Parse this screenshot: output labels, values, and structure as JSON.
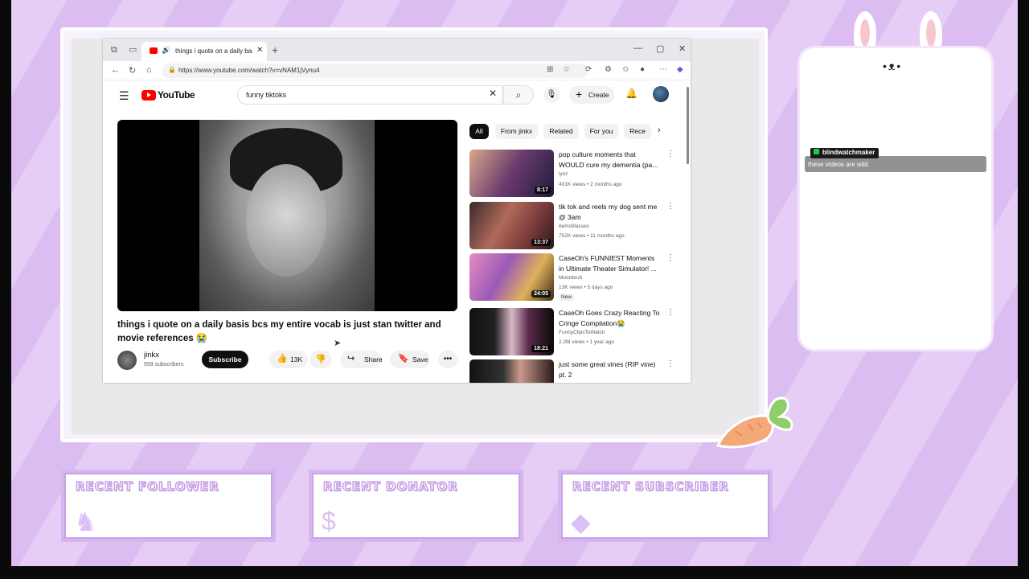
{
  "browser": {
    "tab_title": "things i quote on a daily basis",
    "url": "https://www.youtube.com/watch?v=vNAM1jVynu4"
  },
  "youtube": {
    "logo_text": "YouTube",
    "search_value": "funny tiktoks",
    "create_label": "Create",
    "video_title": "things i quote on a daily basis bcs my entire vocab is just stan twitter and movie references 😭",
    "channel_name": "jinkx",
    "channel_subs": "559 subscribers",
    "subscribe_label": "Subscribe",
    "like_count": "13K",
    "share_label": "Share",
    "save_label": "Save",
    "chips": [
      "All",
      "From jinkx",
      "Related",
      "For you",
      "Rece"
    ],
    "recommendations": [
      {
        "title": "pop culture moments that WOULD cure my dementia (pa...",
        "channel": "iyoz",
        "meta": "401K views • 2 months ago",
        "duration": "8:17",
        "is_new": false
      },
      {
        "title": "tik tok and reels my dog sent me @ 3am",
        "channel": "6ems9lasses",
        "meta": "752K views • 11 months ago",
        "duration": "13:37",
        "is_new": false
      },
      {
        "title": "CaseOh's FUNNIEST Moments in Ultimate Theater Simulator! ...",
        "channel": "Moonbruh",
        "meta": "13K views • 5 days ago",
        "duration": "24:05",
        "is_new": true,
        "new_label": "New"
      },
      {
        "title": "CaseOh Goes Crazy Reacting To Cringe Compilation😭",
        "channel": "FunnyClipsToWatch",
        "meta": "2.2M views • 1 year ago",
        "duration": "18:21",
        "is_new": false
      },
      {
        "title": "just some great vines (RIP vine) pt. 2",
        "channel": "",
        "meta": "",
        "duration": "",
        "is_new": false
      }
    ]
  },
  "chat": {
    "username": "blindwatchmaker",
    "message": "these videos are wild"
  },
  "overlay": {
    "boxes": [
      {
        "title": "RECENT FOLLOWER",
        "icon": "bunny-icon"
      },
      {
        "title": "RECENT DONATOR",
        "icon": "dollar-icon"
      },
      {
        "title": "RECENT SUBSCRIBER",
        "icon": "gem-icon"
      }
    ],
    "colors": {
      "accent": "#d6b6ee",
      "background": "#e6cdf6",
      "youtube_red": "#ff0000"
    }
  }
}
